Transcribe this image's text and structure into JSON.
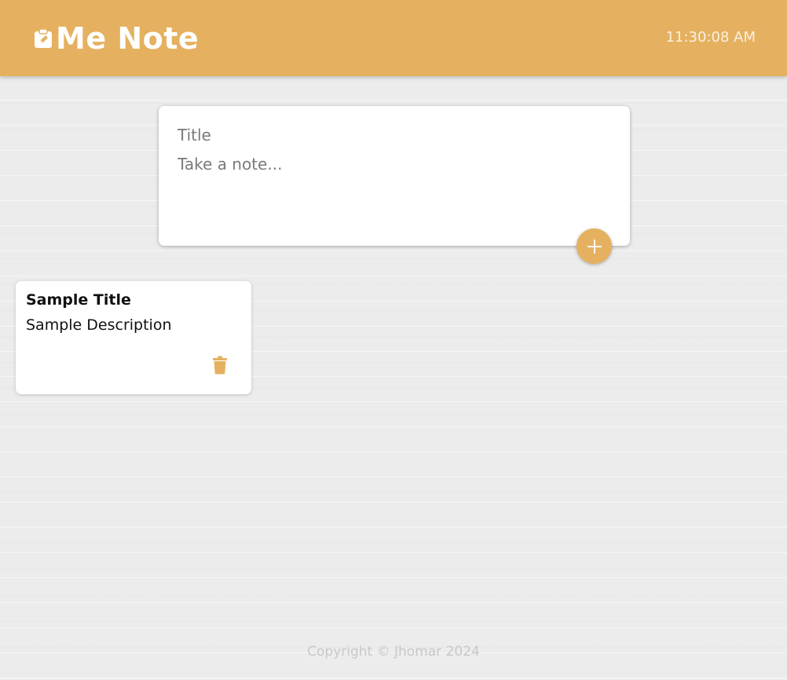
{
  "header": {
    "brand": "Me Note",
    "clock": "11:30:08 AM",
    "brand_icon": "clipboard-edit-icon"
  },
  "composer": {
    "title_placeholder": "Title",
    "note_placeholder": "Take a note...",
    "add_icon": "plus-icon"
  },
  "notes": [
    {
      "title": "Sample Title",
      "description": "Sample Description",
      "delete_icon": "trash-icon"
    }
  ],
  "footer": {
    "text": "Copyright © Jhomar 2024"
  },
  "colors": {
    "accent": "#e5b160",
    "background": "#ececec",
    "card": "#ffffff"
  }
}
